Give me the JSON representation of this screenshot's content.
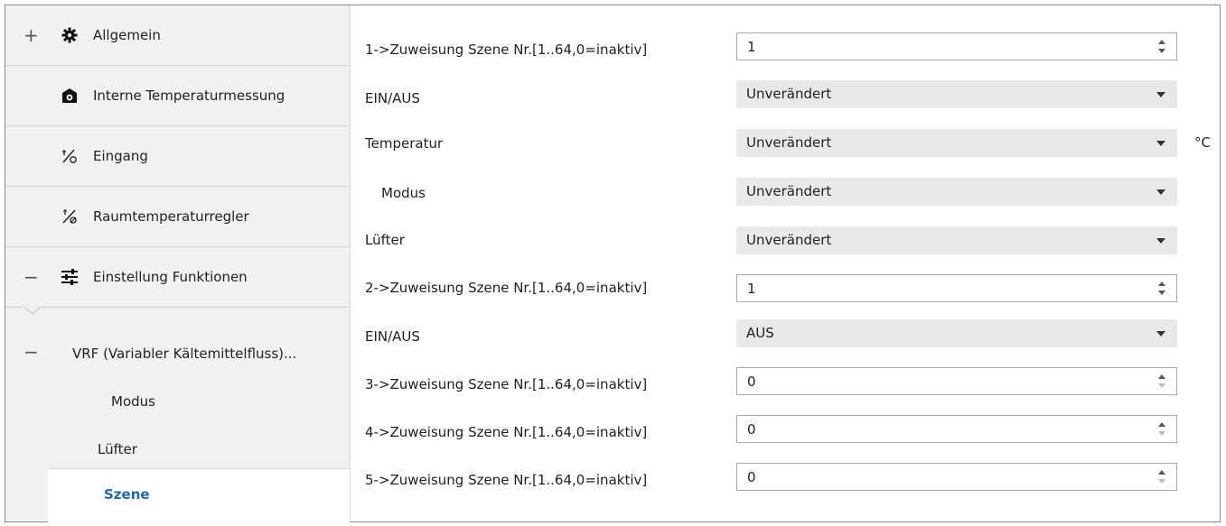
{
  "sidebar": {
    "items": [
      {
        "expander": "+",
        "icon": "gear-icon",
        "label": "Allgemein"
      },
      {
        "expander": "",
        "icon": "thermometer-box-icon",
        "label": "Interne Temperaturmessung"
      },
      {
        "expander": "",
        "icon": "input-sensor-icon",
        "label": "Eingang"
      },
      {
        "expander": "",
        "icon": "room-controller-icon",
        "label": "Raumtemperaturregler"
      },
      {
        "expander": "−",
        "icon": "sliders-icon",
        "label": "Einstellung Funktionen"
      }
    ],
    "sub": {
      "expander": "−",
      "vrf_label": "VRF (Variabler Kältemittelfluss)...",
      "modus_label": "Modus",
      "luefter_label": "Lüfter",
      "szene_label": "Szene"
    }
  },
  "params": [
    {
      "label": "1->Zuweisung Szene Nr.[1..64,0=inaktiv]",
      "type": "spin",
      "value": "1"
    },
    {
      "label": "EIN/AUS",
      "type": "drop",
      "value": "Unverändert"
    },
    {
      "label": "Temperatur",
      "type": "drop",
      "value": "Unverändert",
      "unit": "°C"
    },
    {
      "label": "Modus",
      "type": "drop",
      "value": "Unverändert"
    },
    {
      "label": "Lüfter",
      "type": "drop",
      "value": "Unverändert"
    },
    {
      "label": "2->Zuweisung Szene Nr.[1..64,0=inaktiv]",
      "type": "spin",
      "value": "1"
    },
    {
      "label": "EIN/AUS",
      "type": "drop",
      "value": "AUS"
    },
    {
      "label": "3->Zuweisung Szene Nr.[1..64,0=inaktiv]",
      "type": "spin",
      "value": "0"
    },
    {
      "label": "4->Zuweisung Szene Nr.[1..64,0=inaktiv]",
      "type": "spin",
      "value": "0"
    },
    {
      "label": "5->Zuweisung Szene Nr.[1..64,0=inaktiv]",
      "type": "spin",
      "value": "0"
    }
  ],
  "colors": {
    "selected_text": "#1e66b4",
    "sidebar_bg": "#f1f1f1",
    "dropdown_bg": "#e9e9e9"
  }
}
